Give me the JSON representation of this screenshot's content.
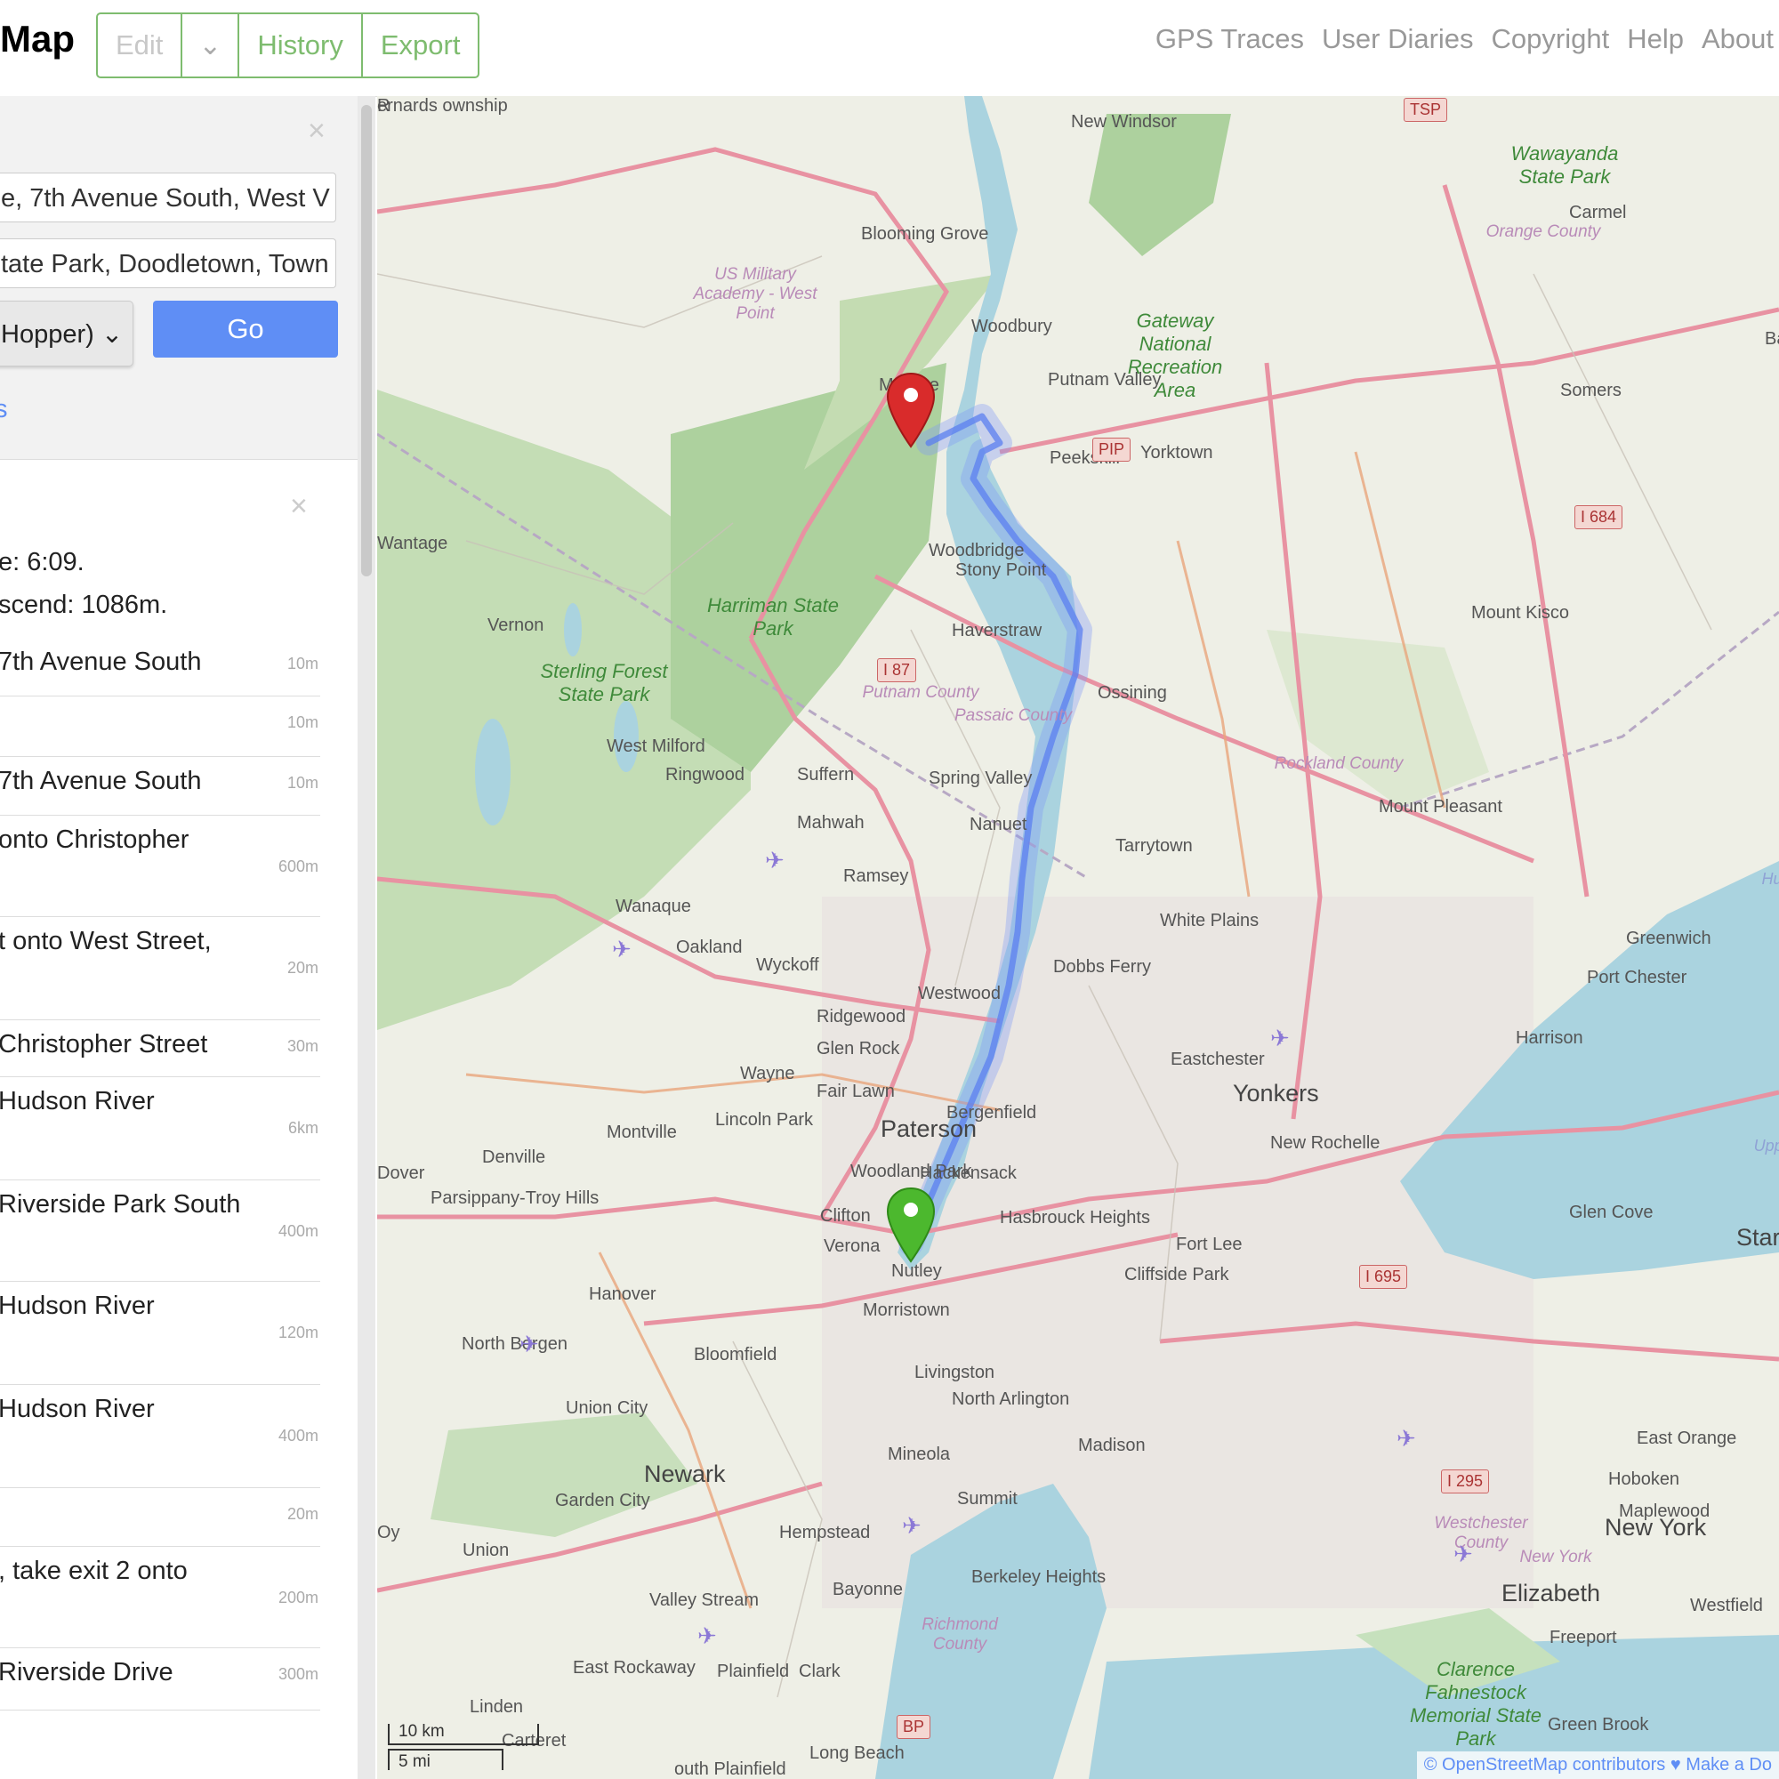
{
  "header": {
    "logo": "Map",
    "edit_label": "Edit",
    "edit_caret": "⌄",
    "history_label": "History",
    "export_label": "Export",
    "nav": [
      "GPS Traces",
      "User Diaries",
      "Copyright",
      "Help",
      "About"
    ]
  },
  "search": {
    "close": "×",
    "from_value": "e, 7th Avenue South, West V",
    "to_value": "tate Park, Doodletown, Town",
    "engine_value": "Hopper)",
    "engine_caret": "⌄",
    "go_label": "Go",
    "reverse_label": "s"
  },
  "directions": {
    "close": "×",
    "time_line": "e: 6:09.",
    "ascend_line": "scend: 1086m.",
    "steps": [
      {
        "text": "7th Avenue South",
        "distance": "10m"
      },
      {
        "text": "",
        "distance": "10m"
      },
      {
        "text": "7th Avenue South",
        "distance": "10m"
      },
      {
        "text": "onto Christopher",
        "distance": "600m"
      },
      {
        "text": "t onto West Street,",
        "distance": "20m"
      },
      {
        "text": "Christopher Street",
        "distance": "30m"
      },
      {
        "text": "Hudson River",
        "distance": "6km"
      },
      {
        "text": "Riverside Park South",
        "distance": "400m"
      },
      {
        "text": "Hudson River",
        "distance": "120m"
      },
      {
        "text": "Hudson River",
        "distance": "400m"
      },
      {
        "text": "",
        "distance": "20m"
      },
      {
        "text": ", take exit 2 onto",
        "distance": "200m"
      },
      {
        "text": "Riverside Drive",
        "distance": "300m"
      }
    ]
  },
  "map": {
    "places": [
      {
        "name": "New Windsor",
        "cls": ""
      },
      {
        "name": "Blooming Grove",
        "cls": ""
      },
      {
        "name": "Woodbury",
        "cls": ""
      },
      {
        "name": "Monroe",
        "cls": ""
      },
      {
        "name": "Putnam Valley",
        "cls": ""
      },
      {
        "name": "Carmel",
        "cls": ""
      },
      {
        "name": "Somers",
        "cls": ""
      },
      {
        "name": "Peekskill",
        "cls": ""
      },
      {
        "name": "Yorktown",
        "cls": ""
      },
      {
        "name": "Wantage",
        "cls": ""
      },
      {
        "name": "Stony Point",
        "cls": ""
      },
      {
        "name": "Mount Kisco",
        "cls": ""
      },
      {
        "name": "Vernon",
        "cls": ""
      },
      {
        "name": "Haverstraw",
        "cls": ""
      },
      {
        "name": "Ossining",
        "cls": ""
      },
      {
        "name": "West Milford",
        "cls": ""
      },
      {
        "name": "Ringwood",
        "cls": ""
      },
      {
        "name": "Suffern",
        "cls": ""
      },
      {
        "name": "Spring Valley",
        "cls": ""
      },
      {
        "name": "Mahwah",
        "cls": ""
      },
      {
        "name": "Nanuet",
        "cls": ""
      },
      {
        "name": "Mount Pleasant",
        "cls": ""
      },
      {
        "name": "Tarrytown",
        "cls": ""
      },
      {
        "name": "Ramsey",
        "cls": ""
      },
      {
        "name": "Wanaque",
        "cls": ""
      },
      {
        "name": "Oakland",
        "cls": ""
      },
      {
        "name": "White Plains",
        "cls": ""
      },
      {
        "name": "Greenwich",
        "cls": ""
      },
      {
        "name": "Wyckoff",
        "cls": ""
      },
      {
        "name": "Dobbs Ferry",
        "cls": ""
      },
      {
        "name": "Port Chester",
        "cls": ""
      },
      {
        "name": "Westwood",
        "cls": ""
      },
      {
        "name": "Ridgewood",
        "cls": ""
      },
      {
        "name": "Glen Rock",
        "cls": ""
      },
      {
        "name": "Harrison",
        "cls": ""
      },
      {
        "name": "Eastchester",
        "cls": ""
      },
      {
        "name": "Wayne",
        "cls": ""
      },
      {
        "name": "Fair Lawn",
        "cls": ""
      },
      {
        "name": "Yonkers",
        "cls": "big"
      },
      {
        "name": "Bergenfield",
        "cls": ""
      },
      {
        "name": "Lincoln Park",
        "cls": ""
      },
      {
        "name": "Paterson",
        "cls": "big"
      },
      {
        "name": "Montville",
        "cls": ""
      },
      {
        "name": "New Rochelle",
        "cls": ""
      },
      {
        "name": "Woodland Park",
        "cls": ""
      },
      {
        "name": "Denville",
        "cls": ""
      },
      {
        "name": "Dover",
        "cls": ""
      },
      {
        "name": "Hackensack",
        "cls": ""
      },
      {
        "name": "Parsippany-Troy Hills",
        "cls": ""
      },
      {
        "name": "Glen Cove",
        "cls": ""
      },
      {
        "name": "Clifton",
        "cls": ""
      },
      {
        "name": "Hasbrouck Heights",
        "cls": ""
      },
      {
        "name": "Fort Lee",
        "cls": ""
      },
      {
        "name": "Verona",
        "cls": ""
      },
      {
        "name": "Nutley",
        "cls": ""
      },
      {
        "name": "Cliffside Park",
        "cls": ""
      },
      {
        "name": "Hanover",
        "cls": ""
      },
      {
        "name": "North Bergen",
        "cls": ""
      },
      {
        "name": "Morristown",
        "cls": ""
      },
      {
        "name": "Bloomfield",
        "cls": ""
      },
      {
        "name": "Livingston",
        "cls": ""
      },
      {
        "name": "North Arlington",
        "cls": ""
      },
      {
        "name": "Union City",
        "cls": ""
      },
      {
        "name": "East Orange",
        "cls": ""
      },
      {
        "name": "Madison",
        "cls": ""
      },
      {
        "name": "Mineola",
        "cls": ""
      },
      {
        "name": "Hoboken",
        "cls": ""
      },
      {
        "name": "Newark",
        "cls": "big"
      },
      {
        "name": "Maplewood",
        "cls": ""
      },
      {
        "name": "Garden City",
        "cls": ""
      },
      {
        "name": "Summit",
        "cls": ""
      },
      {
        "name": "New York",
        "cls": "big"
      },
      {
        "name": "Hempstead",
        "cls": ""
      },
      {
        "name": "Union",
        "cls": ""
      },
      {
        "name": "Berkeley Heights",
        "cls": ""
      },
      {
        "name": "Bayonne",
        "cls": ""
      },
      {
        "name": "Elizabeth",
        "cls": "big"
      },
      {
        "name": "Valley Stream",
        "cls": ""
      },
      {
        "name": "Westfield",
        "cls": ""
      },
      {
        "name": "Freeport",
        "cls": ""
      },
      {
        "name": "East Rockaway",
        "cls": ""
      },
      {
        "name": "Plainfield",
        "cls": ""
      },
      {
        "name": "Clark",
        "cls": ""
      },
      {
        "name": "Linden",
        "cls": ""
      },
      {
        "name": "Green Brook",
        "cls": ""
      },
      {
        "name": "Long Beach",
        "cls": ""
      },
      {
        "name": "Carteret",
        "cls": ""
      },
      {
        "name": "outh Plainfield",
        "cls": ""
      },
      {
        "name": "Woodbridge",
        "cls": ""
      },
      {
        "name": "Harriman State Park",
        "cls": "park"
      },
      {
        "name": "Sterling Forest State Park",
        "cls": "park"
      },
      {
        "name": "Wawayanda State Park",
        "cls": "park"
      },
      {
        "name": "Clarence Fahnestock Memorial State Park",
        "cls": "park"
      },
      {
        "name": "Gateway National Recreation Area",
        "cls": "park"
      },
      {
        "name": "US Military Academy - West Point",
        "cls": "county"
      },
      {
        "name": "Orange County",
        "cls": "county"
      },
      {
        "name": "Putnam County",
        "cls": "county"
      },
      {
        "name": "Rockland County",
        "cls": "county"
      },
      {
        "name": "Westchester County",
        "cls": "county"
      },
      {
        "name": "Passaic County",
        "cls": "county"
      },
      {
        "name": "New York",
        "cls": "county"
      },
      {
        "name": "Richmond County",
        "cls": "county"
      },
      {
        "name": "Hudson River",
        "cls": "water"
      },
      {
        "name": "Upper New York Bay",
        "cls": "water"
      },
      {
        "name": "Star",
        "cls": "big"
      },
      {
        "name": "Bayvil",
        "cls": ""
      },
      {
        "name": "Oy",
        "cls": ""
      },
      {
        "name": "R",
        "cls": ""
      },
      {
        "name": "ernards ownship",
        "cls": ""
      }
    ],
    "shields": [
      "TSP",
      "PIP",
      "I 684",
      "I 87",
      "I 695",
      "I 295",
      "BP"
    ],
    "scale_km": "10 km",
    "scale_mi": "5 mi",
    "attribution": "© OpenStreetMap contributors ♥ Make a Do",
    "colors": {
      "route": "#5b7ff0",
      "start_marker": "#4cb82e",
      "end_marker": "#d92b2b",
      "water": "#aad3df",
      "forest": "#add19e",
      "motorway": "#e892a2"
    }
  }
}
